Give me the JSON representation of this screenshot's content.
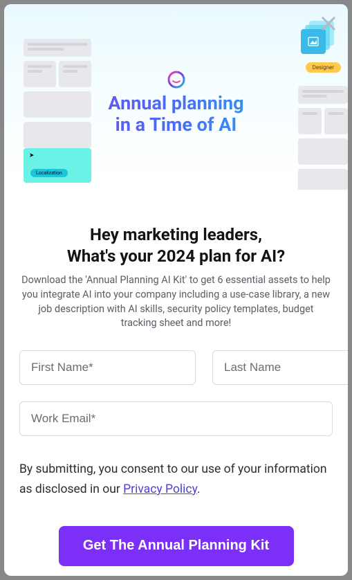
{
  "hero": {
    "title_line1": "Annual planning",
    "title_line2": "in a Time of AI",
    "localization_tag": "Localization",
    "designer_tag": "Designer"
  },
  "heading": {
    "line1": "Hey marketing leaders,",
    "line2": "What's your 2024 plan for AI?"
  },
  "description": "Download the 'Annual Planning AI Kit' to get 6 essential assets to help you integrate AI into your company including a use-case library, a new job description with AI skills, security policy templates, budget tracking sheet and more!",
  "form": {
    "first_name_placeholder": "First Name*",
    "last_name_placeholder": "Last Name",
    "email_placeholder": "Work Email*"
  },
  "consent": {
    "prefix": "By submitting, you consent to our use of your information as disclosed in our ",
    "link_text": "Privacy Policy",
    "suffix": "."
  },
  "cta_label": "Get The Annual Planning Kit"
}
